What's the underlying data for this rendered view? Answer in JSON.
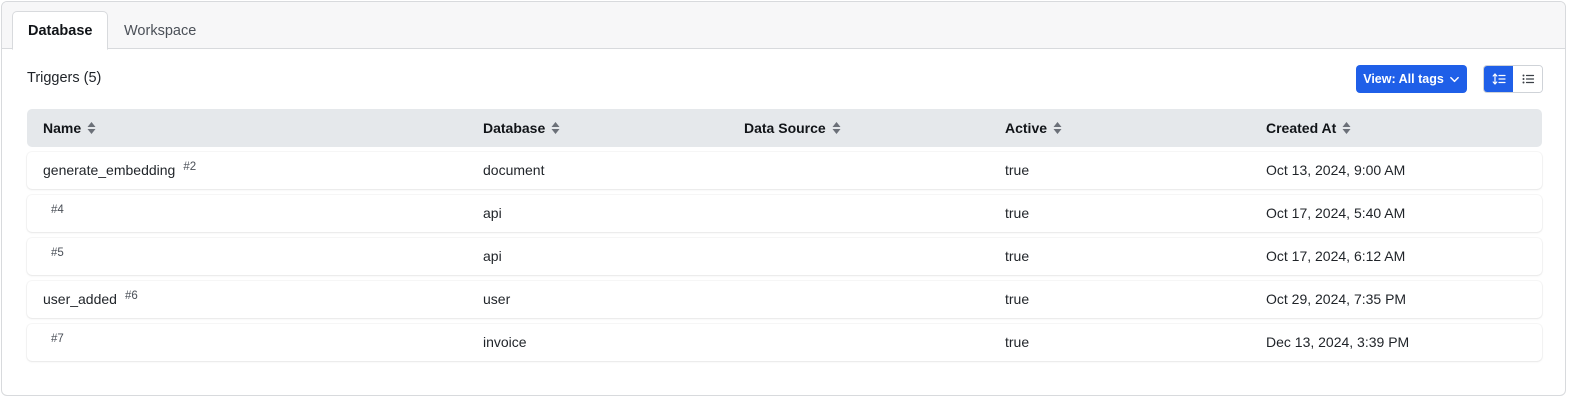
{
  "tabs": [
    {
      "label": "Database",
      "active": true
    },
    {
      "label": "Workspace",
      "active": false
    }
  ],
  "triggers_title": "Triggers (5)",
  "view_button": {
    "label": "View: All tags"
  },
  "columns": [
    "Name",
    "Database",
    "Data Source",
    "Active",
    "Created At"
  ],
  "rows": [
    {
      "name": "generate_embedding",
      "id": "#2",
      "database": "document",
      "data_source": "",
      "active": "true",
      "created_at": "Oct 13, 2024, 9:00 AM"
    },
    {
      "name": "",
      "id": "#4",
      "database": "api",
      "data_source": "",
      "active": "true",
      "created_at": "Oct 17, 2024, 5:40 AM"
    },
    {
      "name": "",
      "id": "#5",
      "database": "api",
      "data_source": "",
      "active": "true",
      "created_at": "Oct 17, 2024, 6:12 AM"
    },
    {
      "name": "user_added",
      "id": "#6",
      "database": "user",
      "data_source": "",
      "active": "true",
      "created_at": "Oct 29, 2024, 7:35 PM"
    },
    {
      "name": "",
      "id": "#7",
      "database": "invoice",
      "data_source": "",
      "active": "true",
      "created_at": "Dec 13, 2024, 3:39 PM"
    }
  ],
  "colors": {
    "accent": "#1f5fe8",
    "header_bg": "#e5e8eb",
    "border": "#d8dadd"
  },
  "icons": {
    "view_dropdown": "chevron-down-icon",
    "toggle_1": "sort-order-list-icon",
    "toggle_2": "bullet-list-icon",
    "column_sort": "sort-arrows-icon"
  }
}
